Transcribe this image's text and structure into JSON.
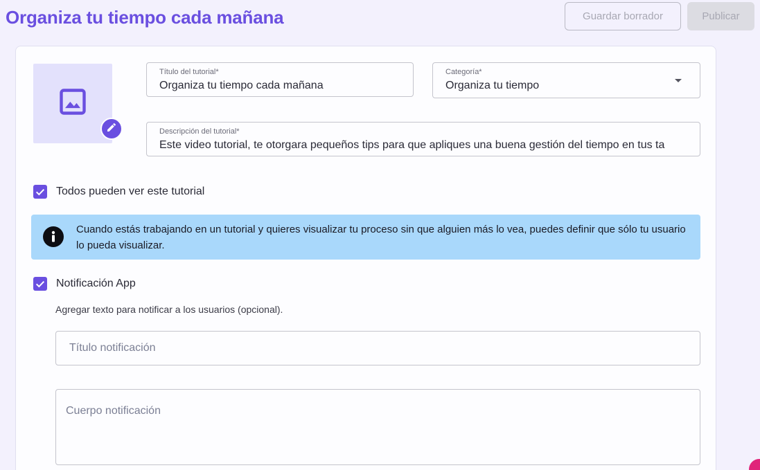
{
  "header": {
    "title": "Organiza tu tiempo cada mañana",
    "draft_label": "Guardar borrador",
    "publish_label": "Publicar"
  },
  "form": {
    "image_icon": "image-icon",
    "edit_icon": "pencil-icon",
    "title_field": {
      "label": "Título del tutorial*",
      "value": "Organiza tu tiempo cada mañana"
    },
    "category_field": {
      "label": "Categoría*",
      "value": "Organiza tu tiempo"
    },
    "description_field": {
      "label": "Descripción del tutorial*",
      "value": "Este video tutorial, te otorgara pequeños tips para que apliques una buena gestión del tiempo en tus ta"
    },
    "visibility_checkbox": {
      "label": "Todos pueden ver este tutorial",
      "checked": true
    },
    "info_banner": {
      "text": "Cuando estás trabajando en un tutorial y quieres visualizar tu proceso sin que alguien más lo vea, puedes definir que sólo tu usuario lo pueda visualizar."
    },
    "notification_checkbox": {
      "label": "Notificación App",
      "checked": true
    },
    "notification_helper": "Agregar texto para notificar a los usuarios (opcional).",
    "notification_title": {
      "placeholder": "Título notificación",
      "value": ""
    },
    "notification_body": {
      "placeholder": "Cuerpo notificación",
      "value": ""
    }
  },
  "colors": {
    "accent": "#6a4fe0",
    "info_background": "#a9d8fb",
    "page_background": "#f3f1fd"
  }
}
